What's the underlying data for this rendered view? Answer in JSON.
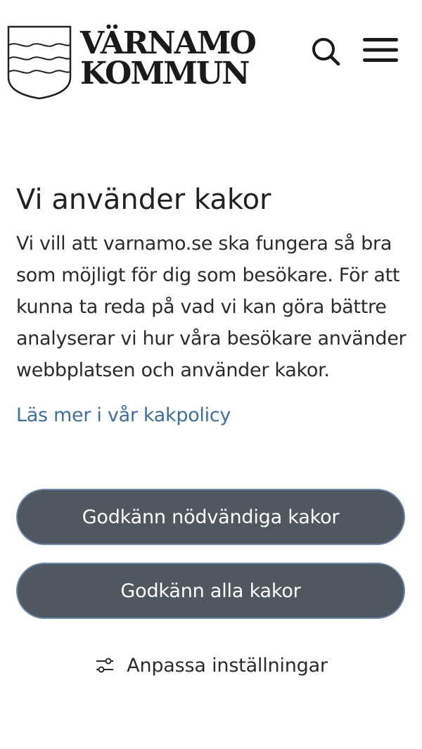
{
  "header": {
    "logo_line1": "VÄRNAMO",
    "logo_line2": "KOMMUN",
    "search_icon": "search-icon",
    "menu_icon": "hamburger-menu-icon"
  },
  "cookie": {
    "title": "Vi använder kakor",
    "description": "Vi vill att varnamo.se ska fungera så bra som möjligt för dig som besökare. För att kunna ta reda på vad vi kan göra bättre analyserar vi hur våra besökare använder webbplatsen och använder kakor.",
    "policy_link": "Läs mer i vår kakpolicy",
    "accept_necessary": "Godkänn nödvändiga kakor",
    "accept_all": "Godkänn alla kakor",
    "customize": "Anpassa inställningar",
    "customize_icon": "sliders-icon"
  },
  "colors": {
    "button_bg": "#4f5761",
    "button_border": "#6d87a8",
    "link": "#3f6f9e",
    "text": "#2b2b2b"
  }
}
